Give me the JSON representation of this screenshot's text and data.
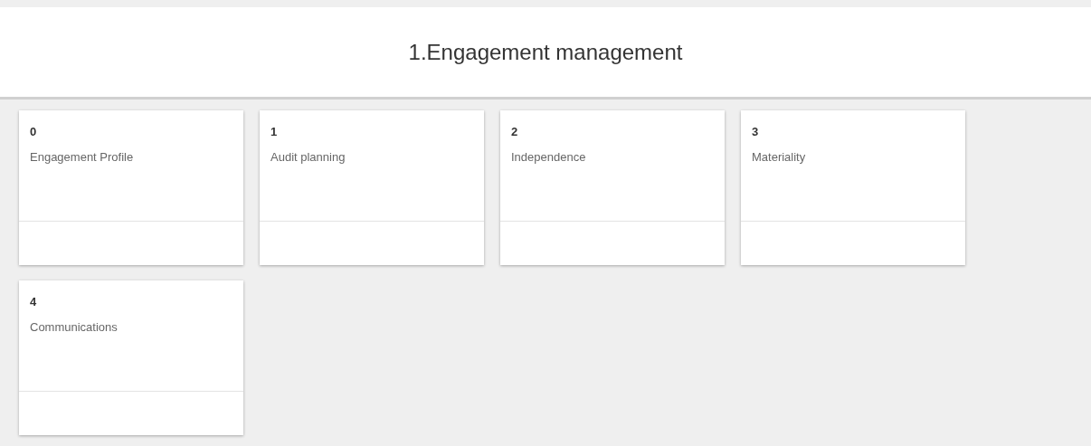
{
  "header": {
    "title": "1.Engagement management"
  },
  "tiles": [
    {
      "number": "0",
      "label": "Engagement Profile"
    },
    {
      "number": "1",
      "label": "Audit planning"
    },
    {
      "number": "2",
      "label": "Independence"
    },
    {
      "number": "3",
      "label": "Materiality"
    },
    {
      "number": "4",
      "label": "Communications"
    }
  ]
}
